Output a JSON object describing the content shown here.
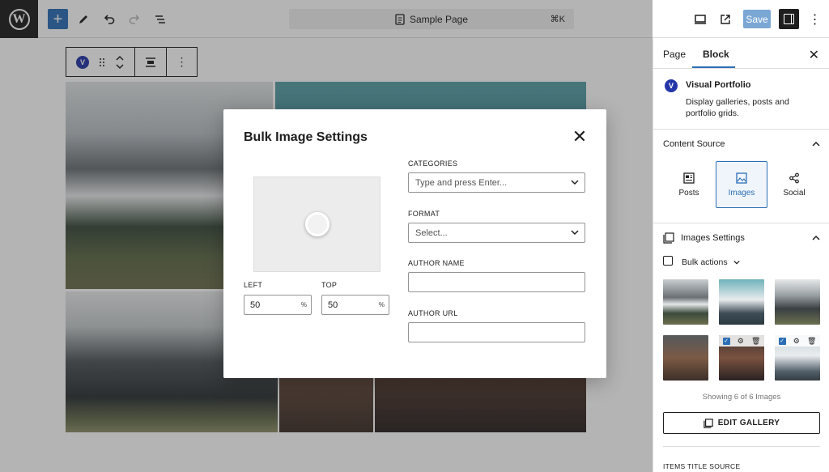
{
  "topbar": {
    "logo_letter": "W",
    "add_label": "+",
    "command_title": "Sample Page",
    "command_shortcut": "⌘K",
    "save_label": "Save",
    "more_label": "⋮"
  },
  "modal": {
    "title": "Bulk Image Settings",
    "close_label": "✕",
    "left_label": "LEFT",
    "left_value": "50",
    "top_label": "TOP",
    "top_value": "50",
    "unit": "%",
    "categories_label": "CATEGORIES",
    "categories_placeholder": "Type and press Enter...",
    "format_label": "FORMAT",
    "format_placeholder": "Select...",
    "author_name_label": "AUTHOR NAME",
    "author_url_label": "AUTHOR URL"
  },
  "sidebar": {
    "tabs": [
      "Page",
      "Block"
    ],
    "close_label": "✕",
    "block_title": "Visual Portfolio",
    "block_badge": "V",
    "block_desc": "Display galleries, posts and portfolio grids.",
    "content_source_title": "Content Source",
    "sources": [
      {
        "label": "Posts",
        "icon": "posts-icon"
      },
      {
        "label": "Images",
        "icon": "images-icon"
      },
      {
        "label": "Social",
        "icon": "share-icon"
      }
    ],
    "images_settings_title": "Images Settings",
    "bulk_actions_label": "Bulk actions",
    "showing_text": "Showing 6 of 6 Images",
    "edit_gallery_label": "EDIT GALLERY",
    "items_title_source": "ITEMS TITLE SOURCE"
  },
  "block_toolbar": {
    "badge": "V"
  },
  "colors": {
    "accent": "#2c6eb5",
    "save_disabled": "#7ba7d4",
    "dark": "#1e1e1e",
    "vp_badge": "#2536a8"
  }
}
